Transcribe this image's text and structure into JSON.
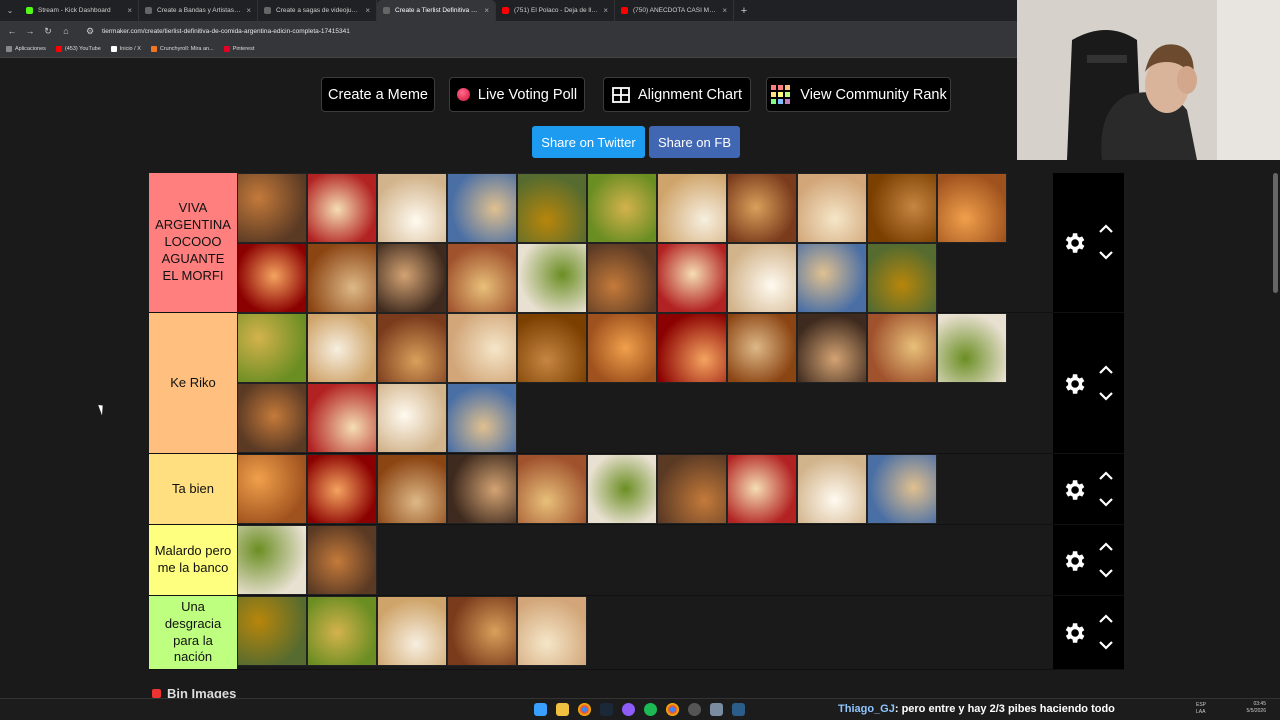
{
  "browser": {
    "tabs": [
      {
        "title": "Stream - Kick Dashboard",
        "fav": "#53fc18",
        "active": false
      },
      {
        "title": "Create a Bandas y Artistas de RockArg Tier List",
        "fav": "#666",
        "active": false
      },
      {
        "title": "Create a sagas de videojuegos Tier List",
        "fav": "#666",
        "active": false
      },
      {
        "title": "Create a Tierlist Definitiva de Comida Argentina",
        "fav": "#666",
        "active": true
      },
      {
        "title": "(751) El Polaco - Deja de llorar",
        "fav": "#ff0000",
        "active": false
      },
      {
        "title": "(750) ANÉCDOTA CASI ME MATAN",
        "fav": "#ff0000",
        "active": false
      }
    ],
    "url": "tiermaker.com/create/tierlist-definitiva-de-comida-argentina-edicin-completa-17415341",
    "bookmarks": [
      {
        "label": "Aplicaciones",
        "color": "#888"
      },
      {
        "label": "(453) YouTube",
        "color": "#ff0000"
      },
      {
        "label": "Inicio / X",
        "color": "#ffffff"
      },
      {
        "label": "Crunchyroll: Mira an...",
        "color": "#f47521"
      },
      {
        "label": "Pinterest",
        "color": "#e60023"
      }
    ]
  },
  "toolbar": {
    "create_meme": "Create a Meme",
    "live_voting": "Live Voting Poll",
    "alignment_chart": "Alignment Chart",
    "community_rank": "View Community Rank",
    "share_twitter": "Share on Twitter",
    "share_fb": "Share on FB"
  },
  "tiers": [
    {
      "label": "VIVA ARGENTINA LOCOOO AGUANTE EL MORFI",
      "color": "#ff7f7f",
      "item_count": 21
    },
    {
      "label": "Ke Riko",
      "color": "#ffbf7f",
      "item_count": 15
    },
    {
      "label": "Ta bien",
      "color": "#ffdf7f",
      "item_count": 10
    },
    {
      "label": "Malardo pero me la banco",
      "color": "#ffff7f",
      "item_count": 2
    },
    {
      "label": "Una desgracia para la nación",
      "color": "#bfff7f",
      "item_count": 5
    }
  ],
  "bin_images": "Bin Images",
  "taskbar": {
    "chat_user": "Thiago_GJ",
    "chat_message": ": pero entre y hay 2/3 pibes haciendo todo",
    "lang": "ESP",
    "lang_sub": "LAA",
    "time": "03:45",
    "date": "5/5/2026"
  }
}
